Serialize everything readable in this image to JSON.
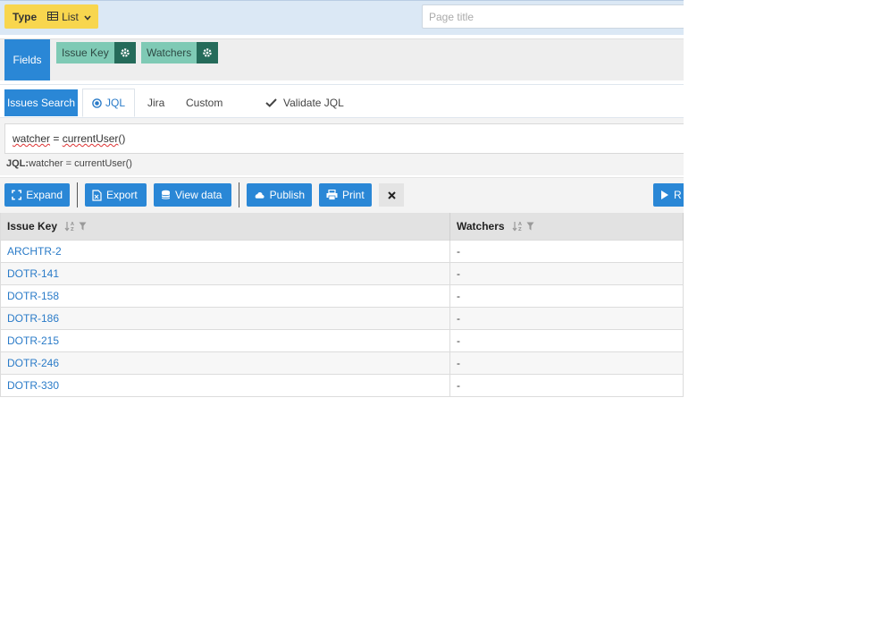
{
  "topbar": {
    "type_label": "Type",
    "type_value": "List",
    "page_title_placeholder": "Page title"
  },
  "fields": {
    "label": "Fields",
    "chips": [
      {
        "label": "Issue Key"
      },
      {
        "label": "Watchers"
      }
    ]
  },
  "search": {
    "label": "Issues Search",
    "tabs": [
      {
        "label": "JQL"
      },
      {
        "label": "Jira"
      },
      {
        "label": "Custom"
      }
    ],
    "validate_label": "Validate JQL",
    "jql_word1": "watcher",
    "jql_eq": " = ",
    "jql_word2": "currentUser",
    "jql_paren": "()",
    "preview_prefix": "JQL:",
    "preview_value": "watcher = currentUser()"
  },
  "toolbar": {
    "expand": "Expand",
    "export": "Export",
    "view_data": "View data",
    "publish": "Publish",
    "print": "Print",
    "run_partial": "R"
  },
  "table": {
    "columns": [
      "Issue Key",
      "Watchers"
    ],
    "rows": [
      {
        "key": "ARCHTR-2",
        "watchers": "-"
      },
      {
        "key": "DOTR-141",
        "watchers": "-"
      },
      {
        "key": "DOTR-158",
        "watchers": "-"
      },
      {
        "key": "DOTR-186",
        "watchers": "-"
      },
      {
        "key": "DOTR-215",
        "watchers": "-"
      },
      {
        "key": "DOTR-246",
        "watchers": "-"
      },
      {
        "key": "DOTR-330",
        "watchers": "-"
      }
    ]
  },
  "colors": {
    "accent": "#2a87d6",
    "type_button": "#f8d64e",
    "chip": "#7fcab5",
    "chip_gear": "#256b5a",
    "link": "#2a7bc8"
  }
}
